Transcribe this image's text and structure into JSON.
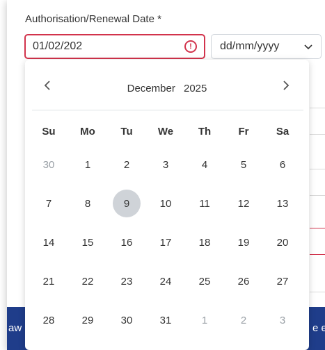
{
  "form": {
    "label": "Authorisation/Renewal Date *",
    "date_value": "01/02/202",
    "error_icon_glyph": "!",
    "format_value": "dd/mm/yyyy",
    "error_color": "#d2334c"
  },
  "background": {
    "bar_left_text": "aw a",
    "bar_right_text": "e ex"
  },
  "calendar": {
    "month": "December",
    "year": "2025",
    "prev_glyph": "‹",
    "next_glyph": "›",
    "weekdays": [
      "Su",
      "Mo",
      "Tu",
      "We",
      "Th",
      "Fr",
      "Sa"
    ],
    "weeks": [
      [
        {
          "d": "30",
          "m": true
        },
        {
          "d": "1"
        },
        {
          "d": "2"
        },
        {
          "d": "3"
        },
        {
          "d": "4"
        },
        {
          "d": "5"
        },
        {
          "d": "6"
        }
      ],
      [
        {
          "d": "7"
        },
        {
          "d": "8"
        },
        {
          "d": "9",
          "sel": true
        },
        {
          "d": "10"
        },
        {
          "d": "11"
        },
        {
          "d": "12"
        },
        {
          "d": "13"
        }
      ],
      [
        {
          "d": "14"
        },
        {
          "d": "15"
        },
        {
          "d": "16"
        },
        {
          "d": "17"
        },
        {
          "d": "18"
        },
        {
          "d": "19"
        },
        {
          "d": "20"
        }
      ],
      [
        {
          "d": "21"
        },
        {
          "d": "22"
        },
        {
          "d": "23"
        },
        {
          "d": "24"
        },
        {
          "d": "25"
        },
        {
          "d": "26"
        },
        {
          "d": "27"
        }
      ],
      [
        {
          "d": "28"
        },
        {
          "d": "29"
        },
        {
          "d": "30"
        },
        {
          "d": "31"
        },
        {
          "d": "1",
          "m": true
        },
        {
          "d": "2",
          "m": true
        },
        {
          "d": "3",
          "m": true
        }
      ]
    ]
  }
}
